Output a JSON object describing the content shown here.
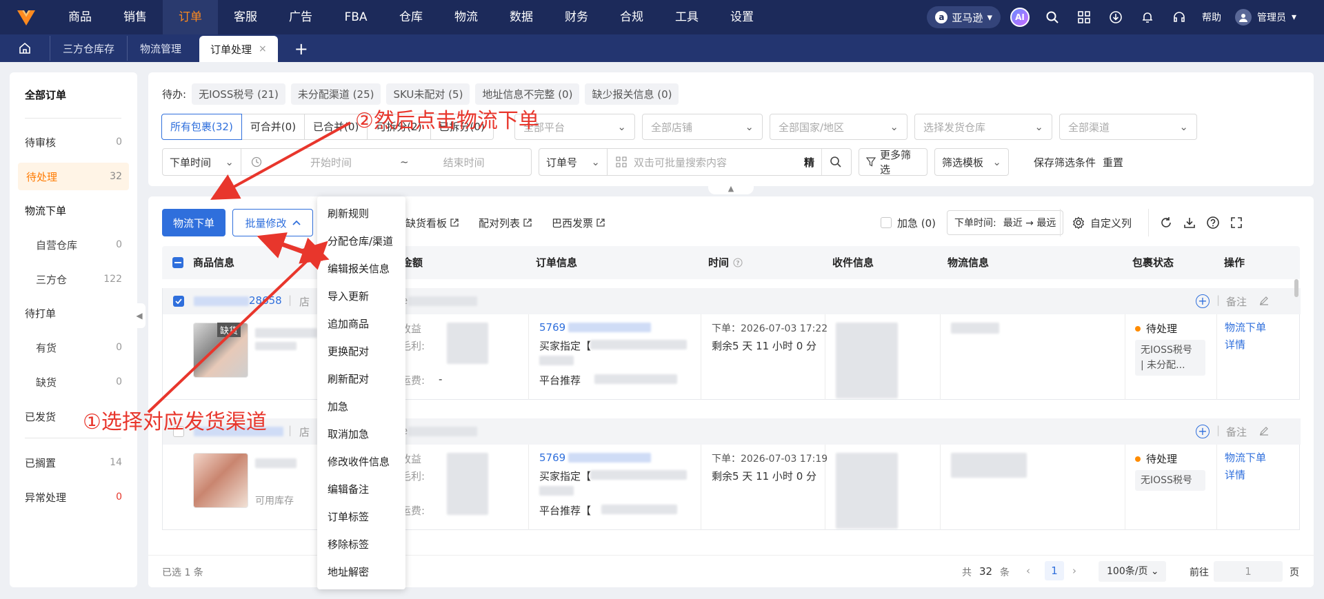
{
  "topnav": {
    "items": [
      "商品",
      "销售",
      "订单",
      "客服",
      "广告",
      "FBA",
      "仓库",
      "物流",
      "数据",
      "财务",
      "合规",
      "工具",
      "设置"
    ],
    "active_index": 2,
    "store": "亚马逊",
    "ai": "AI",
    "help": "帮助",
    "user": "管理员",
    "accent_color": "#ff8a1f",
    "bg_color": "#1c2a5a"
  },
  "tabs": {
    "items": [
      "三方仓库存",
      "物流管理"
    ],
    "active": "订单处理",
    "close": "×",
    "add": "+"
  },
  "sidebar": {
    "all": "全部订单",
    "pending_review": {
      "label": "待审核",
      "count": "0"
    },
    "processing": {
      "label": "待处理",
      "count": "32"
    },
    "logistics": "物流下单",
    "self_wh": {
      "label": "自营仓库",
      "count": "0"
    },
    "third_wh": {
      "label": "三方仓",
      "count": "122"
    },
    "to_print": "待打单",
    "in_stock": {
      "label": "有货",
      "count": "0"
    },
    "out_stock": {
      "label": "缺货",
      "count": "0"
    },
    "shipped": "已发货",
    "shelved": {
      "label": "已搁置",
      "count": "14"
    },
    "exception": {
      "label": "异常处理",
      "count": "0"
    }
  },
  "filter": {
    "todo_label": "待办:",
    "todo_chips": [
      "无IOSS税号 (21)",
      "未分配渠道 (25)",
      "SKU未配对 (5)",
      "地址信息不完整 (0)",
      "缺少报关信息 (0)"
    ],
    "segments": [
      "所有包裹(32)",
      "可合并(0)",
      "已合并(0)",
      "可拆分(2)",
      "已拆分(0)"
    ],
    "platform": "全部平台",
    "shop": "全部店铺",
    "country": "全部国家/地区",
    "warehouse": "选择发货仓库",
    "channel": "全部渠道",
    "time_type": "下单时间",
    "start_time": "开始时间",
    "tilde": "~",
    "end_time": "结束时间",
    "search_type": "订单号",
    "search_placeholder": "双击可批量搜索内容",
    "precise": "精",
    "more_filter": "更多筛选",
    "template": "筛选模板",
    "save": "保存筛选条件",
    "reset": "重置"
  },
  "toolbar": {
    "logistics_order": "物流下单",
    "batch_edit": "批量修改",
    "links": [
      "缺货看板",
      "配对列表",
      "巴西发票"
    ],
    "urgent": "加急 (0)",
    "sort_label": "下单时间:",
    "sort_value": "最近 → 最远",
    "custom_cols": "自定义列"
  },
  "table": {
    "headers": [
      "商品信息",
      "金额",
      "订单信息",
      "时间",
      "收件信息",
      "物流信息",
      "包裹状态",
      "操作"
    ],
    "rows": [
      {
        "id_suffix": "28658",
        "shop_prefix": "店",
        "order_prefix": "5769",
        "buyer_spec": "买家指定【",
        "platform_rec": "平台推荐",
        "amount_labels": [
          "收益",
          "毛利:",
          "运费:"
        ],
        "freight": "-",
        "order_time": "下单：2026-07-03 17:22",
        "remaining": "剩余5 天 11 小时 0 分",
        "status": "待处理",
        "status_tags": "无IOSS税号\n| 未分配...",
        "ops": [
          "物流下单",
          "详情"
        ],
        "note": "备注",
        "out_of_stock_tag": "缺货",
        "store_prefix": "e"
      },
      {
        "id_suffix": "",
        "shop_prefix": "店",
        "order_prefix": "5769",
        "buyer_spec": "买家指定【",
        "platform_rec": "平台推荐【",
        "amount_labels": [
          "收益",
          "毛利:",
          "运费:"
        ],
        "available_stock": "可用库存",
        "order_time": "下单：2026-07-03 17:19",
        "remaining": "剩余5 天 11 小时 0 分",
        "status": "待处理",
        "status_tags": "无IOSS税号",
        "ops": [
          "物流下单",
          "详情"
        ],
        "note": "备注",
        "store_prefix": "e"
      }
    ]
  },
  "footer": {
    "selected": "已选 1 条",
    "total_prefix": "共",
    "total": "32",
    "total_suffix": "条",
    "page": "1",
    "per_page": "100条/页",
    "goto": "前往",
    "goto_value": "1",
    "page_suffix": "页"
  },
  "dropdown": {
    "items": [
      "刷新规则",
      "分配仓库/渠道",
      "编辑报关信息",
      "导入更新",
      "追加商品",
      "更换配对",
      "刷新配对",
      "加急",
      "取消加急",
      "修改收件信息",
      "编辑备注",
      "订单标签",
      "移除标签",
      "地址解密"
    ]
  },
  "annotations": {
    "step1": "①选择对应发货渠道",
    "step2": "②然后点击物流下单",
    "color": "#e8362c"
  }
}
